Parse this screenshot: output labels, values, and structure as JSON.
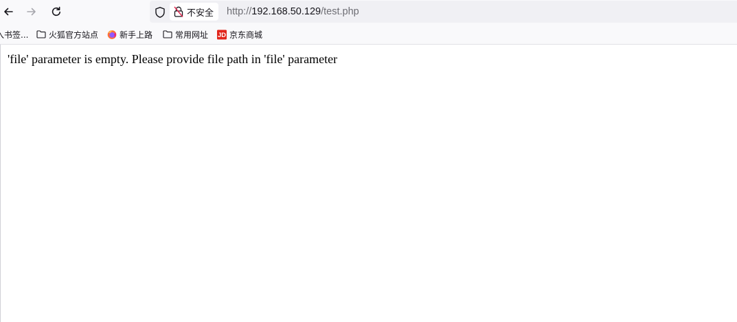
{
  "navbar": {
    "back_icon": "arrow-left-icon",
    "forward_icon": "arrow-right-icon",
    "reload_icon": "reload-icon",
    "urlbar": {
      "shield_icon": "shield-icon",
      "security_label": "不安全",
      "url_scheme": "http://",
      "url_host": "192.168.50.129",
      "url_path": "/test.php"
    }
  },
  "bookmarks": {
    "items": [
      {
        "label": "入书签...",
        "icon": "none"
      },
      {
        "label": "火狐官方站点",
        "icon": "folder-icon"
      },
      {
        "label": "新手上路",
        "icon": "firefox-icon"
      },
      {
        "label": "常用网址",
        "icon": "folder-icon"
      },
      {
        "label": "京东商城",
        "icon": "jd-icon"
      }
    ]
  },
  "page": {
    "message": "'file' parameter is empty. Please provide file path in 'file' parameter"
  },
  "colors": {
    "toolbar_bg": "#f9f9fb",
    "urlbar_bg": "#f0f0f4",
    "text": "#15141a",
    "muted": "#6d6d73",
    "jd_red": "#e1251b"
  }
}
